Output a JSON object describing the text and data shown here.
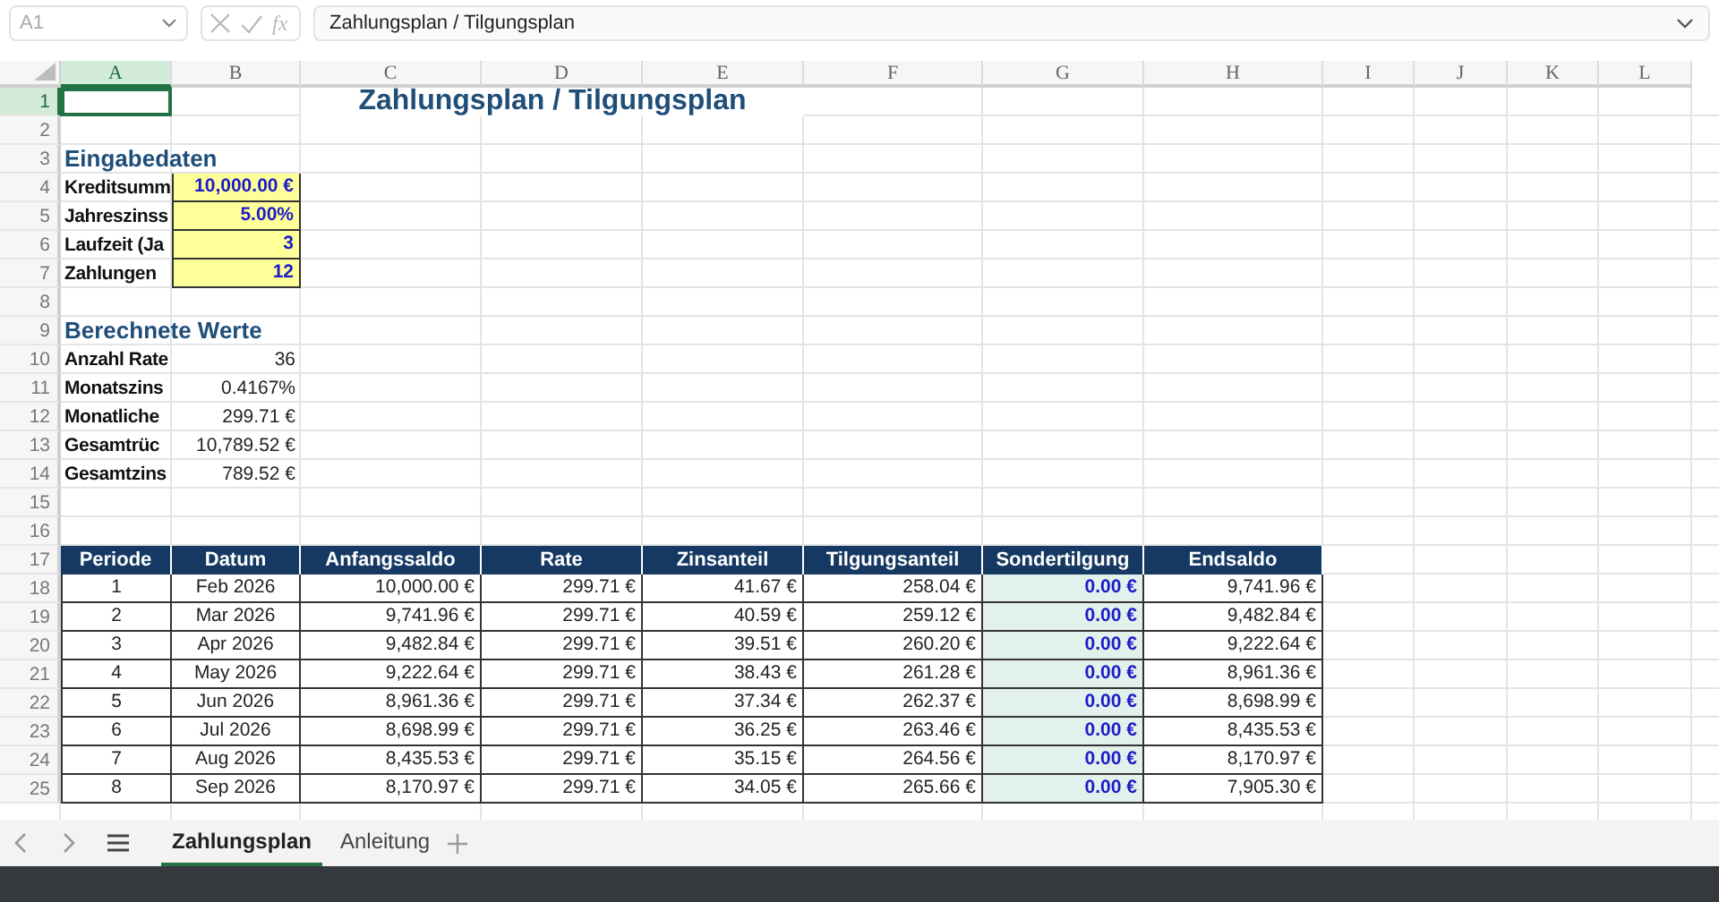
{
  "formula_bar": {
    "name_box": "A1",
    "function_label": "fx",
    "formula": "Zahlungsplan / Tilgungsplan"
  },
  "columns": [
    {
      "label": "A",
      "selected": true
    },
    {
      "label": "B",
      "selected": false
    },
    {
      "label": "C",
      "selected": false
    },
    {
      "label": "D",
      "selected": false
    },
    {
      "label": "E",
      "selected": false
    },
    {
      "label": "F",
      "selected": false
    },
    {
      "label": "G",
      "selected": false
    },
    {
      "label": "H",
      "selected": false
    },
    {
      "label": "I",
      "selected": false
    },
    {
      "label": "J",
      "selected": false
    },
    {
      "label": "K",
      "selected": false
    },
    {
      "label": "L",
      "selected": false
    }
  ],
  "rows": [
    {
      "label": "1",
      "selected": true
    },
    {
      "label": "2",
      "selected": false
    },
    {
      "label": "3",
      "selected": false
    },
    {
      "label": "4",
      "selected": false
    },
    {
      "label": "5",
      "selected": false
    },
    {
      "label": "6",
      "selected": false
    },
    {
      "label": "7",
      "selected": false
    },
    {
      "label": "8",
      "selected": false
    },
    {
      "label": "9",
      "selected": false
    },
    {
      "label": "10",
      "selected": false
    },
    {
      "label": "11",
      "selected": false
    },
    {
      "label": "12",
      "selected": false
    },
    {
      "label": "13",
      "selected": false
    },
    {
      "label": "14",
      "selected": false
    },
    {
      "label": "15",
      "selected": false
    },
    {
      "label": "16",
      "selected": false
    },
    {
      "label": "17",
      "selected": false
    },
    {
      "label": "18",
      "selected": false
    },
    {
      "label": "19",
      "selected": false
    },
    {
      "label": "20",
      "selected": false
    },
    {
      "label": "21",
      "selected": false
    },
    {
      "label": "22",
      "selected": false
    },
    {
      "label": "23",
      "selected": false
    },
    {
      "label": "24",
      "selected": false
    },
    {
      "label": "25",
      "selected": false
    }
  ],
  "title": "Zahlungsplan / Tilgungsplan",
  "inputs": {
    "heading": "Eingabedaten",
    "items": [
      {
        "label": "Kreditsumm",
        "value": "10,000.00 €"
      },
      {
        "label": "Jahreszinss",
        "value": "5.00%"
      },
      {
        "label": "Laufzeit (Ja",
        "value": "3"
      },
      {
        "label": "Zahlungen",
        "value": "12"
      }
    ]
  },
  "calculated": {
    "heading": "Berechnete Werte",
    "items": [
      {
        "label": "Anzahl Rate",
        "value": "36"
      },
      {
        "label": "Monatszins",
        "value": "0.4167%"
      },
      {
        "label": "Monatliche",
        "value": "299.71 €"
      },
      {
        "label": "Gesamtrüc",
        "value": "10,789.52 €"
      },
      {
        "label": "Gesamtzins",
        "value": "789.52 €"
      }
    ]
  },
  "table": {
    "columns": [
      {
        "label": "Periode",
        "kind": "center"
      },
      {
        "label": "Datum",
        "kind": "center"
      },
      {
        "label": "Anfangssaldo",
        "kind": "amount"
      },
      {
        "label": "Rate",
        "kind": "amount"
      },
      {
        "label": "Zinsanteil",
        "kind": "amount"
      },
      {
        "label": "Tilgungsanteil",
        "kind": "amount"
      },
      {
        "label": "Sondertilgung",
        "kind": "input"
      },
      {
        "label": "Endsaldo",
        "kind": "amount"
      }
    ],
    "rows": [
      [
        "1",
        "Feb 2026",
        "10,000.00 €",
        "299.71 €",
        "41.67 €",
        "258.04 €",
        "0.00 €",
        "9,741.96 €"
      ],
      [
        "2",
        "Mar 2026",
        "9,741.96 €",
        "299.71 €",
        "40.59 €",
        "259.12 €",
        "0.00 €",
        "9,482.84 €"
      ],
      [
        "3",
        "Apr 2026",
        "9,482.84 €",
        "299.71 €",
        "39.51 €",
        "260.20 €",
        "0.00 €",
        "9,222.64 €"
      ],
      [
        "4",
        "May 2026",
        "9,222.64 €",
        "299.71 €",
        "38.43 €",
        "261.28 €",
        "0.00 €",
        "8,961.36 €"
      ],
      [
        "5",
        "Jun 2026",
        "8,961.36 €",
        "299.71 €",
        "37.34 €",
        "262.37 €",
        "0.00 €",
        "8,698.99 €"
      ],
      [
        "6",
        "Jul 2026",
        "8,698.99 €",
        "299.71 €",
        "36.25 €",
        "263.46 €",
        "0.00 €",
        "8,435.53 €"
      ],
      [
        "7",
        "Aug 2026",
        "8,435.53 €",
        "299.71 €",
        "35.15 €",
        "264.56 €",
        "0.00 €",
        "8,170.97 €"
      ],
      [
        "8",
        "Sep 2026",
        "8,170.97 €",
        "299.71 €",
        "34.05 €",
        "265.66 €",
        "0.00 €",
        "7,905.30 €"
      ]
    ]
  },
  "sheet_tabs": [
    {
      "label": "Zahlungsplan",
      "selected": true
    },
    {
      "label": "Anleitung",
      "selected": false
    }
  ]
}
